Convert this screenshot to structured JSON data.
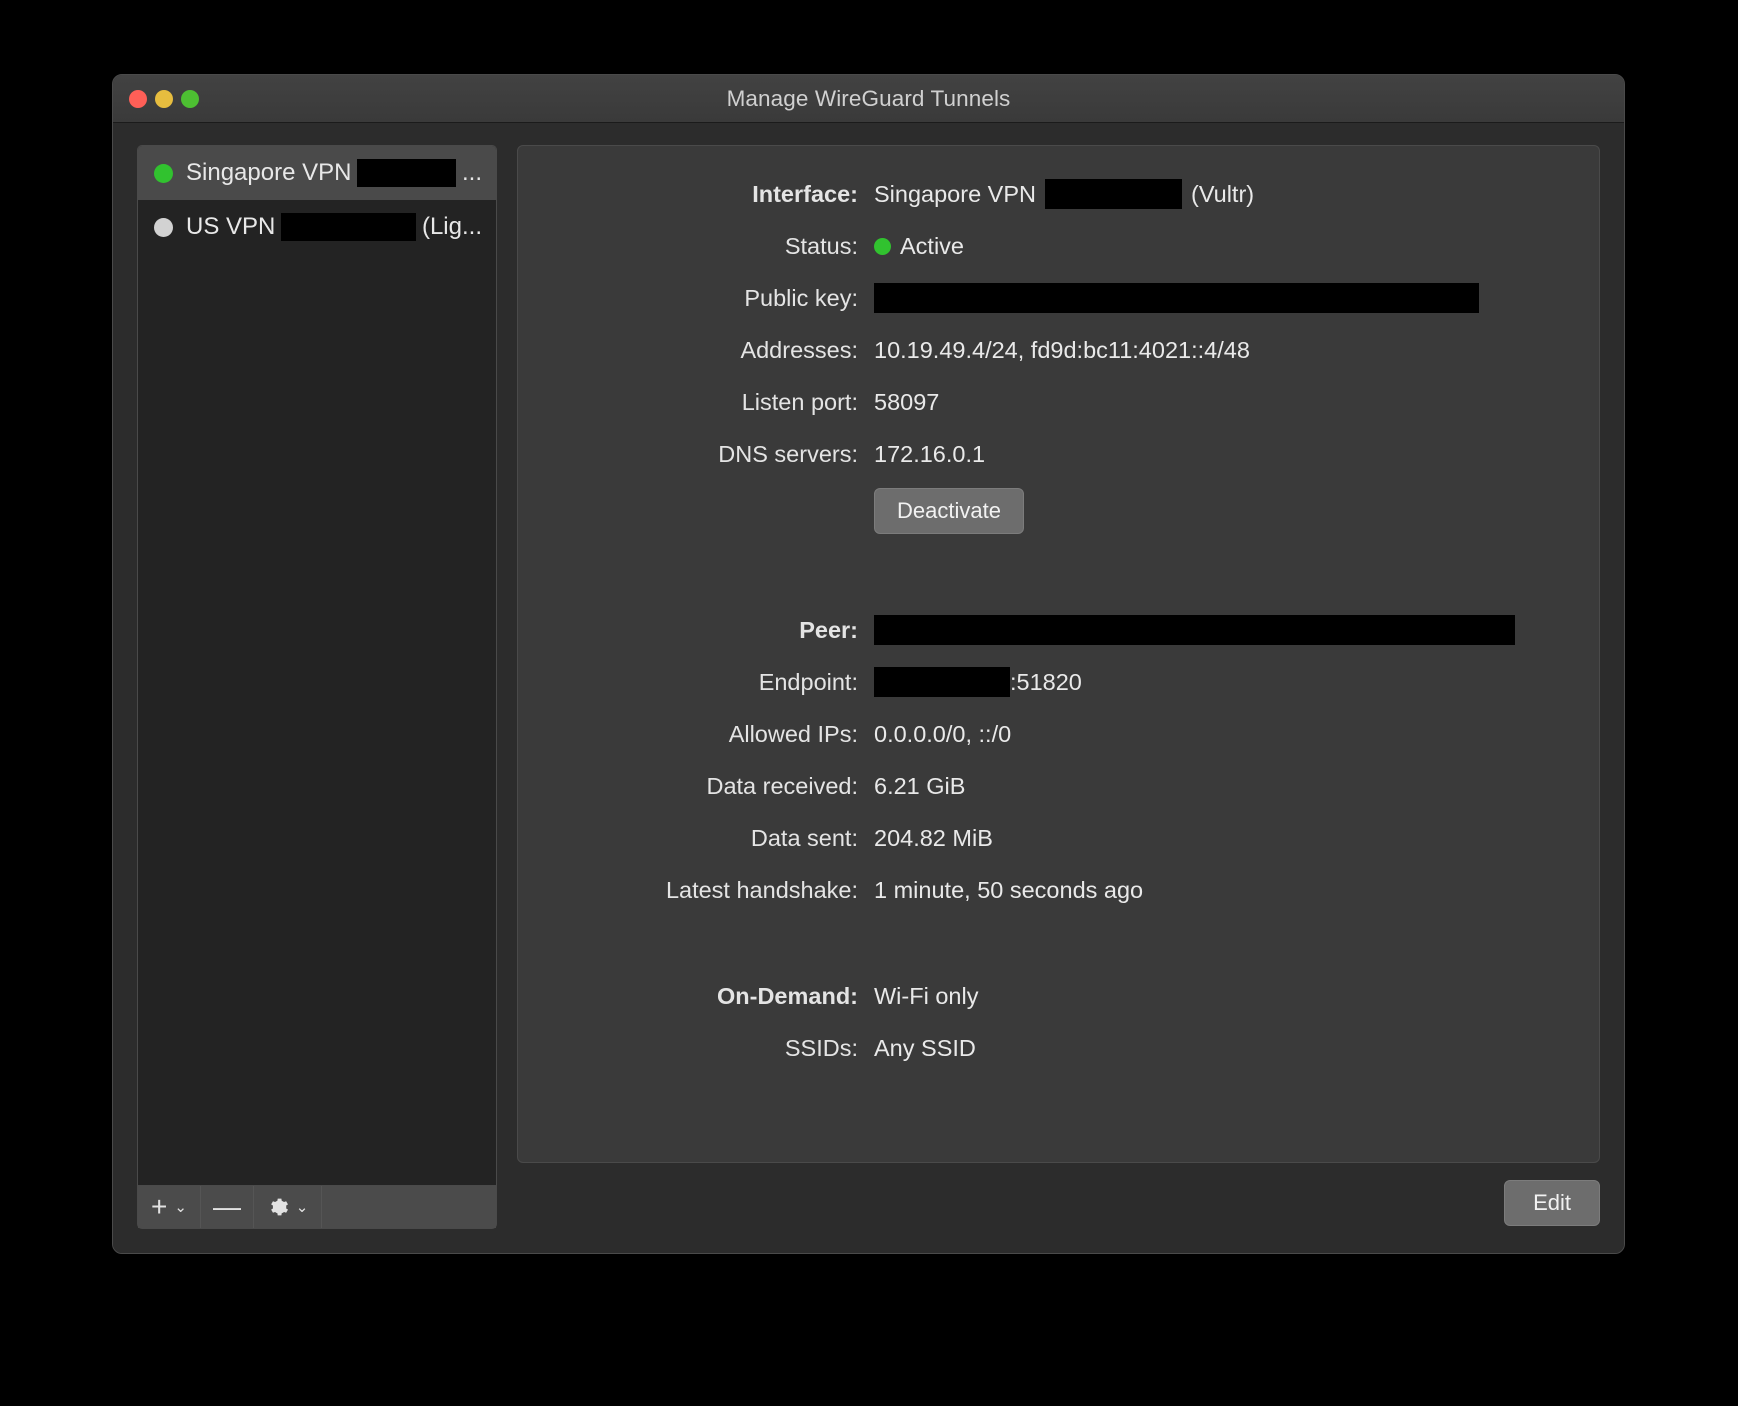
{
  "window": {
    "title": "Manage WireGuard Tunnels",
    "traffic_lights": {
      "close": "close-button",
      "minimize": "minimize-button",
      "maximize": "maximize-button"
    }
  },
  "sidebar": {
    "tunnels": [
      {
        "name": "Singapore VPN",
        "suffix": "...",
        "status": "active",
        "selected": true,
        "redacted": true
      },
      {
        "name": "US VPN",
        "suffix": "(Lig...",
        "status": "inactive",
        "selected": false,
        "redacted": true
      }
    ],
    "toolbar": {
      "add_label": "+",
      "add_chevron": "⌄",
      "remove_label": "—",
      "gear_icon": "gear-icon",
      "gear_chevron": "⌄"
    }
  },
  "details": {
    "interface": {
      "label": "Interface:",
      "name": "Singapore VPN",
      "provider": "(Vultr)"
    },
    "status": {
      "label": "Status:",
      "value": "Active"
    },
    "public_key": {
      "label": "Public key:",
      "value": ""
    },
    "addresses": {
      "label": "Addresses:",
      "value": "10.19.49.4/24, fd9d:bc11:4021::4/48"
    },
    "listen_port": {
      "label": "Listen port:",
      "value": "58097"
    },
    "dns_servers": {
      "label": "DNS servers:",
      "value": "172.16.0.1"
    },
    "deactivate_button": "Deactivate",
    "peer": {
      "label": "Peer:",
      "value": ""
    },
    "endpoint": {
      "label": "Endpoint:",
      "port": ":51820"
    },
    "allowed_ips": {
      "label": "Allowed IPs:",
      "value": "0.0.0.0/0, ::/0"
    },
    "data_received": {
      "label": "Data received:",
      "value": "6.21 GiB"
    },
    "data_sent": {
      "label": "Data sent:",
      "value": "204.82 MiB"
    },
    "latest_handshake": {
      "label": "Latest handshake:",
      "value": "1 minute, 50 seconds ago"
    },
    "on_demand": {
      "label": "On-Demand:",
      "value": "Wi-Fi only"
    },
    "ssids": {
      "label": "SSIDs:",
      "value": "Any SSID"
    }
  },
  "footer": {
    "edit_button": "Edit"
  },
  "colors": {
    "active_green": "#31c22f",
    "inactive_gray": "#d2d2d2",
    "window_bg": "#2c2c2c",
    "panel_bg": "#3a3a3a",
    "list_bg": "#232323"
  }
}
